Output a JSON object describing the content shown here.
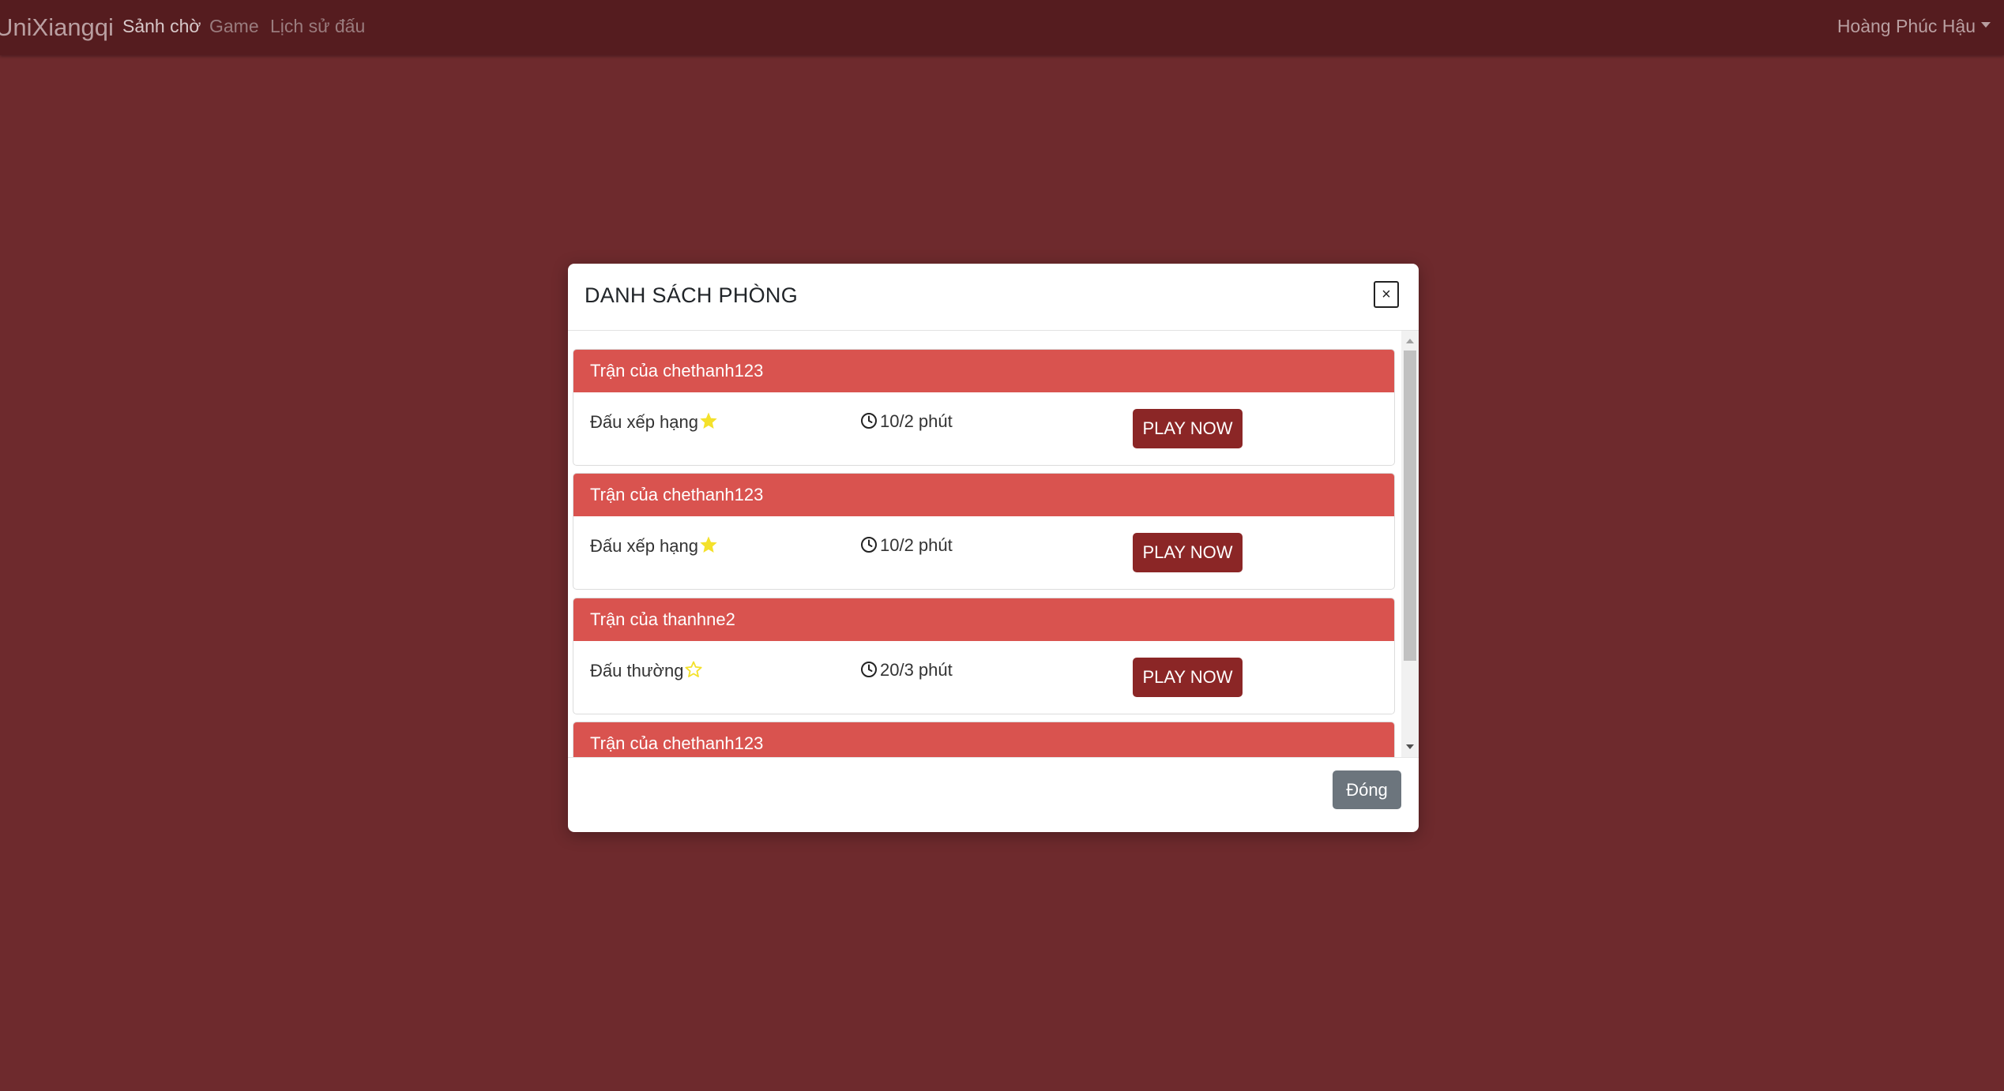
{
  "navbar": {
    "brand": "UniXiangqi",
    "links": [
      {
        "label": "Sảnh chờ",
        "active": true
      },
      {
        "label": "Game",
        "active": false
      },
      {
        "label": "Lịch sử đấu",
        "active": false
      }
    ],
    "user_name": "Hoàng Phúc Hậu"
  },
  "modal": {
    "title": "DANH SÁCH PHÒNG",
    "close_symbol": "×",
    "rooms": [
      {
        "title": "Trận của chethanh123",
        "type": "Đấu xếp hạng",
        "star": "filled",
        "time": "10/2 phút",
        "action": "PLAY NOW"
      },
      {
        "title": "Trận của chethanh123",
        "type": "Đấu xếp hạng",
        "star": "filled",
        "time": "10/2 phút",
        "action": "PLAY NOW"
      },
      {
        "title": "Trận của thanhne2",
        "type": "Đấu thường",
        "star": "outline",
        "time": "20/3 phút",
        "action": "PLAY NOW"
      },
      {
        "title": "Trận của chethanh123"
      }
    ],
    "footer_button": "Đóng"
  },
  "colors": {
    "page_bg": "#6e2a2d",
    "navbar_bg": "#551c1f",
    "room_header": "#d9534f",
    "play_button": "#8b2626",
    "star": "#f4e12b",
    "secondary_button": "#6c757d"
  }
}
